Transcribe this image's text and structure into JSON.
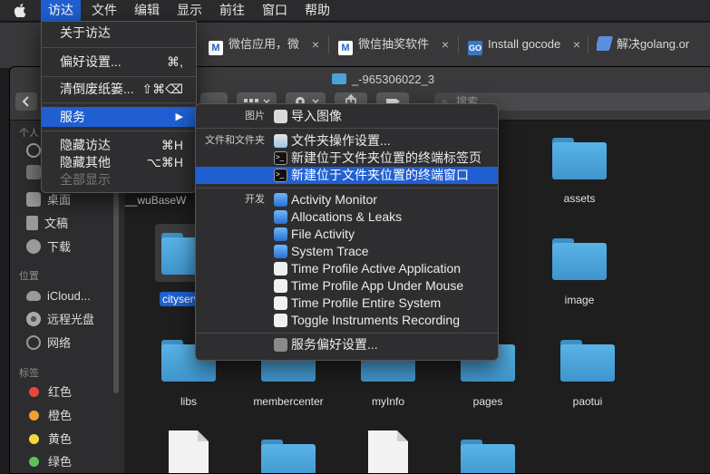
{
  "menubar": {
    "items": [
      {
        "label": "访达",
        "active": true
      },
      {
        "label": "文件"
      },
      {
        "label": "编辑"
      },
      {
        "label": "显示"
      },
      {
        "label": "前往"
      },
      {
        "label": "窗口"
      },
      {
        "label": "帮助"
      }
    ]
  },
  "browser": {
    "tabs": [
      {
        "icon_text": "M",
        "label": "微信应用，微",
        "close": "×"
      },
      {
        "icon_text": "M",
        "label": "微信抽奖软件",
        "close": "×"
      },
      {
        "icon_text": "GO",
        "label": "Install gocode",
        "close": "×"
      },
      {
        "icon_text": "",
        "label": "解决golang.or",
        "close": "×"
      }
    ]
  },
  "finder": {
    "title": "_-965306022_3",
    "search_placeholder": "搜索",
    "sidebar": {
      "section_personal_fragment": "个人",
      "fragment_items": [],
      "favorites": [
        {
          "label": "桌面",
          "icon": "desktop-icon"
        },
        {
          "label": "文稿",
          "icon": "documents-icon"
        },
        {
          "label": "下载",
          "icon": "downloads-icon"
        }
      ],
      "section_locations": "位置",
      "locations": [
        {
          "label": "iCloud...",
          "icon": "cloud-icon"
        },
        {
          "label": "远程光盘",
          "icon": "disc-icon"
        },
        {
          "label": "网络",
          "icon": "network-icon"
        }
      ],
      "section_tags": "标签",
      "tags": [
        {
          "label": "红色",
          "color": "#e8453c"
        },
        {
          "label": "橙色",
          "color": "#f0a030"
        },
        {
          "label": "黄色",
          "color": "#f5d83a"
        },
        {
          "label": "绿色",
          "color": "#5cc35a"
        }
      ]
    },
    "files": {
      "row1_left": "__wuBaseW",
      "row1_right": "assets",
      "row2_left": "cityserv",
      "row2_right": "image",
      "row3": [
        "libs",
        "membercenter",
        "myInfo",
        "pages",
        "paotui"
      ]
    }
  },
  "main_menu": {
    "items": [
      {
        "label": "关于访达",
        "shortcut": ""
      },
      {
        "label": "偏好设置...",
        "shortcut": "⌘,"
      },
      {
        "label": "清倒废纸篓...",
        "shortcut": "⇧⌘⌫"
      },
      {
        "label": "服务",
        "shortcut": "▶"
      },
      {
        "label": "隐藏访达",
        "shortcut": "⌘H"
      },
      {
        "label": "隐藏其他",
        "shortcut": "⌥⌘H"
      },
      {
        "label": "全部显示",
        "shortcut": ""
      }
    ]
  },
  "services_menu": {
    "categories": {
      "pictures": "图片",
      "files_folders": "文件和文件夹",
      "development": "开发"
    },
    "items": [
      {
        "label": "导入图像",
        "icon": "camera-icon"
      },
      {
        "label": "文件夹操作设置...",
        "icon": "folder-action-icon"
      },
      {
        "label": "新建位于文件夹位置的终端标签页",
        "icon": "terminal-icon"
      },
      {
        "label": "新建位于文件夹位置的终端窗口",
        "icon": "terminal-icon"
      },
      {
        "label": "Activity Monitor",
        "icon": "instruments-icon"
      },
      {
        "label": "Allocations & Leaks",
        "icon": "instruments-icon"
      },
      {
        "label": "File Activity",
        "icon": "instruments-icon"
      },
      {
        "label": "System Trace",
        "icon": "instruments-icon"
      },
      {
        "label": "Time Profile Active Application",
        "icon": "timer-icon"
      },
      {
        "label": "Time Profile App Under Mouse",
        "icon": "timer-icon"
      },
      {
        "label": "Time Profile Entire System",
        "icon": "timer-icon"
      },
      {
        "label": "Toggle Instruments Recording",
        "icon": "timer-icon"
      },
      {
        "label": "服务偏好设置...",
        "icon": "gear-icon"
      }
    ]
  }
}
